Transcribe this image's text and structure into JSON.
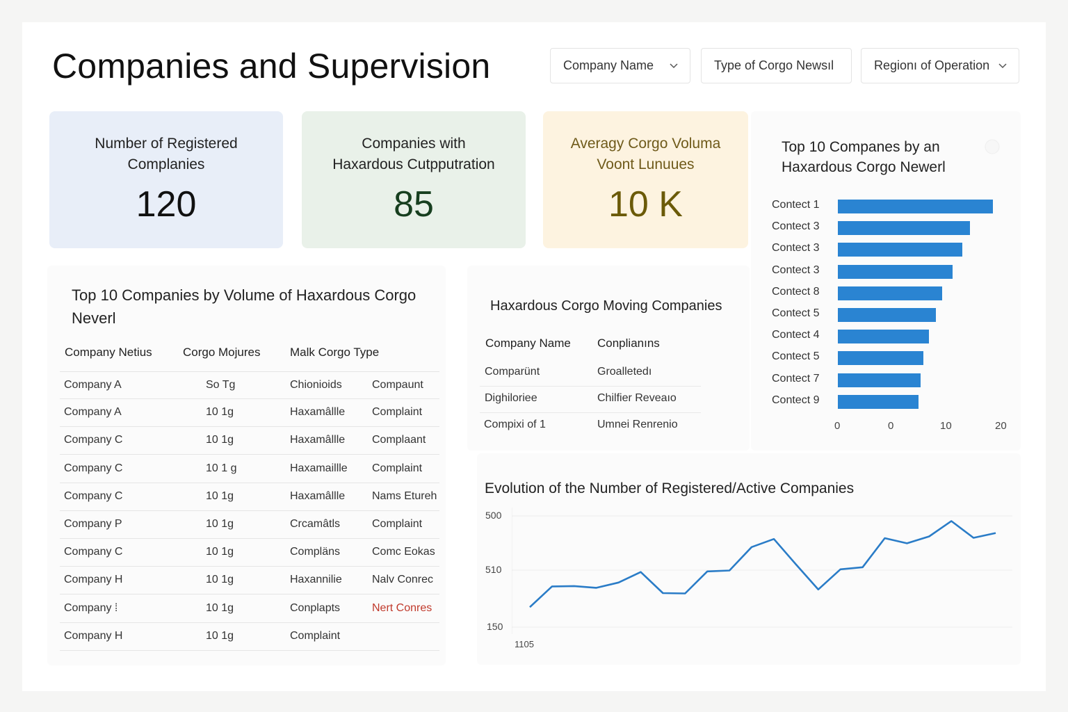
{
  "header": {
    "title": "Companies and Supervision"
  },
  "filters": [
    {
      "label": "Company Name",
      "has_chevron": true
    },
    {
      "label": "Type of Corgo Newsıl",
      "has_chevron": false
    },
    {
      "label": "Regionı of Operation",
      "has_chevron": true
    }
  ],
  "kpis": [
    {
      "label": "Number of Registered Complanies",
      "value": "120",
      "bg": "#e8eef8",
      "value_color": "#111111"
    },
    {
      "label": "Companies with Haxardous Cutpputration",
      "value": "85",
      "bg": "#e9f1e9",
      "value_color": "#173f1f"
    },
    {
      "label": "Averagy Corgo Voluma Voont Lunuues",
      "value": "10 K",
      "bg": "#fdf3e0",
      "value_color": "#6b5a08",
      "label_color": "#6f5a1a"
    }
  ],
  "top10_table": {
    "title": "Top 10 Companies by Volume of Haxardous Corgo Neverl",
    "columns": [
      "Company Netius",
      "Corgo Mojures",
      "Malk Corgo Type"
    ],
    "rows": [
      [
        "Company A",
        "So Tg",
        "Chionioids",
        "Compaunt"
      ],
      [
        "Company A",
        "10 1g",
        "Haxamâllle",
        "Complaint"
      ],
      [
        "Company C",
        "10 1g",
        "Haxamâllle",
        "Complaant"
      ],
      [
        "Company C",
        "10 1 g",
        "Haxamaillle",
        "Complaint"
      ],
      [
        "Company C",
        "10 1g",
        "Haxamâllle",
        "Nams Etureh"
      ],
      [
        "Company P",
        "10 1g",
        "Crcamâtls",
        "Complaint"
      ],
      [
        "Company C",
        "10 1g",
        "Compläns",
        "Comc Eokas"
      ],
      [
        "Company H",
        "10 1g",
        "Haxannilie",
        "Nalv Conrec"
      ],
      [
        "Company ⁞",
        "10 1g",
        "Conplapts",
        "Nert Conres"
      ],
      [
        "Company H",
        "10 1g",
        "Complaint",
        ""
      ]
    ],
    "alert_color": "#c0392b"
  },
  "hazardous_moving": {
    "title": "Haxardous Corgo Moving Companies",
    "columns": [
      "Company Name",
      "Conplianıns"
    ],
    "rows": [
      [
        "Comparünt",
        "Groalletedı"
      ],
      [
        "Dighiloriee",
        "Chilfier Reveaıo"
      ],
      [
        "Comрixi of 1",
        "Umnei Renrenio"
      ]
    ]
  },
  "bar_chart": {
    "title": "Top 10 Companes by an Haxardous Corgo Newerl",
    "chart_data": {
      "type": "bar",
      "orientation": "horizontal",
      "categories": [
        "Contect 1",
        "Contect 3",
        "Contect 3",
        "Contect 3",
        "Contect 8",
        "Contect 5",
        "Contect 4",
        "Contect 5",
        "Contect 7",
        "Contect 9"
      ],
      "values": [
        18.7,
        15.9,
        15.0,
        13.8,
        12.6,
        11.8,
        11.0,
        10.3,
        10.0,
        9.7
      ],
      "x_ticks": [
        "0",
        "0",
        "10",
        "20"
      ],
      "xlim": [
        0,
        20
      ],
      "color": "#2a84d2"
    }
  },
  "line_chart": {
    "title": "Evolution of the Number of Registered/Active Companies",
    "chart_data": {
      "type": "line",
      "y_ticks": [
        "500",
        "510",
        "150"
      ],
      "x_ticks": [
        "1105"
      ],
      "values": [
        1.17,
        2.38,
        2.4,
        2.3,
        2.61,
        3.22,
        1.99,
        1.97,
        3.26,
        3.31,
        4.68,
        5.15,
        3.66,
        2.2,
        3.38,
        3.5,
        5.2,
        4.9,
        5.3,
        6.2,
        5.22,
        5.5
      ],
      "ylim": [
        0,
        6.5
      ],
      "color": "#2a7cc7"
    }
  }
}
